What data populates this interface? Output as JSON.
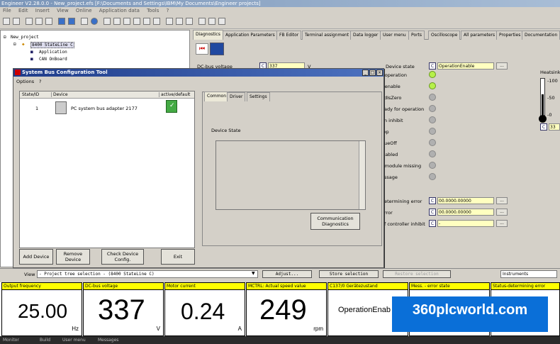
{
  "app": {
    "title": "Engineer V2.28.0.0 - New_project.efs [F:\\Documents and Settings\\IBM\\My Documents\\Engineer projects]"
  },
  "menu": [
    "File",
    "Edit",
    "Insert",
    "View",
    "Online",
    "Application data",
    "Tools",
    "?"
  ],
  "tree": {
    "root": "New_project",
    "device": "8400 StateLine C",
    "children": [
      "Application",
      "CAN OnBoard"
    ]
  },
  "tabs": [
    "Diagnostics",
    "Application Parameters",
    "FB Editor",
    "Terminal assignment",
    "Data logger",
    "User menu",
    "Ports",
    "Oscilloscope",
    "All parameters",
    "Properties",
    "Documentation"
  ],
  "diagnostics": {
    "dc_bus_label": "DC-bus voltage",
    "dc_bus_code": "C",
    "dc_bus_value": "337",
    "dc_bus_unit": "V",
    "device_state_label": "Device state",
    "device_state_code": "C",
    "device_state_value": "OperationEnable",
    "status_labels": [
      "r operation",
      "r enable",
      "edIsZero",
      "eady for operation",
      "on inhibit",
      "top",
      "queOff",
      "isabled",
      "r module missing",
      "essage"
    ],
    "status_leds": [
      "green",
      "green",
      "grey",
      "grey",
      "grey",
      "grey",
      "grey",
      "grey",
      "grey",
      "grey"
    ],
    "error_rows": [
      {
        "label": "determining error",
        "code": "C",
        "value": "00.0000.00000"
      },
      {
        "label": "error",
        "code": "C",
        "value": "00.0000.00000"
      },
      {
        "label": "of controller inhibit",
        "code": "C",
        "value": "-"
      }
    ],
    "heatsink_label": "Heatsink",
    "heatsink_ticks": [
      "100",
      "50",
      "0"
    ],
    "heatsink_code": "C",
    "heatsink_value": "33",
    "ellipsis": "..."
  },
  "dialog": {
    "title": "System Bus Configuration Tool",
    "menu": [
      "Options",
      "?"
    ],
    "columns": [
      "State/ID",
      "Device",
      "active/default"
    ],
    "rows": [
      {
        "state": "1",
        "device": "PC system bus adapter 2177"
      }
    ],
    "tabs": [
      "Common",
      "Driver",
      "Settings"
    ],
    "device_state_label": "Device State",
    "comm_button": "Communication Diagnostics",
    "buttons": [
      "Add Device",
      "Remove Device",
      "Check Device Config.",
      "Exit"
    ]
  },
  "bottom": {
    "view_label": "View",
    "view_value": "- Project tree selection -  (8400 StateLine C)",
    "adjust": "Adjust...",
    "store": "Store selection",
    "restore": "Restore selection",
    "instruments": "Instruments"
  },
  "monitors": [
    {
      "header": "Output frequency",
      "value": "25.00",
      "unit": "Hz"
    },
    {
      "header": "DC-bus voltage",
      "value": "337",
      "unit": "V"
    },
    {
      "header": "Motor current",
      "value": "0.24",
      "unit": "A"
    },
    {
      "header": "MCTRL: Actual speed value",
      "value": "249",
      "unit": "rpm"
    },
    {
      "header": "C137/0 Gerätezustand",
      "value": "OperationEnab",
      "unit": ""
    },
    {
      "header": "Mess. - error state",
      "value": "",
      "unit": ""
    },
    {
      "header": "Status-determining error",
      "value": "",
      "unit": ""
    }
  ],
  "statusbar": [
    "Monitor",
    "Build",
    "User menu",
    "Messages"
  ],
  "watermark": "360plcworld.com"
}
